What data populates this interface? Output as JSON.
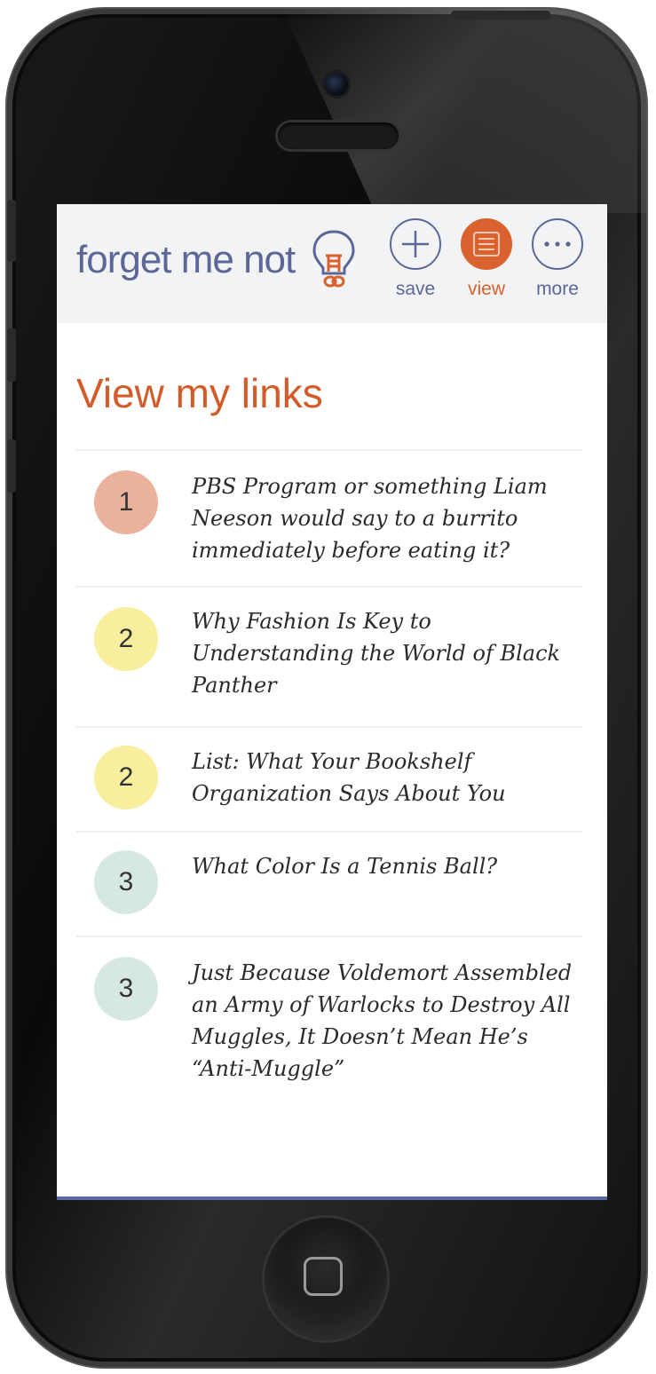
{
  "app": {
    "logo_text": "forget me not"
  },
  "nav": {
    "save_label": "save",
    "view_label": "view",
    "more_label": "more"
  },
  "page": {
    "title": "View my links"
  },
  "links": [
    {
      "rank": "1",
      "title": "PBS Program or something Liam Neeson would say to a burrito immediately before eating it?",
      "color": "#eab19c"
    },
    {
      "rank": "2",
      "title": "Why Fashion Is Key to Understanding the World of Black Panther",
      "color": "#f7ee9e"
    },
    {
      "rank": "2",
      "title": "List: What Your Bookshelf Organization Says About You",
      "color": "#f7ee9e"
    },
    {
      "rank": "3",
      "title": "What Color Is a Tennis Ball?",
      "color": "#d6e8e3"
    },
    {
      "rank": "3",
      "title": "Just Because Voldemort Assembled an Army of Warlocks to Destroy All Muggles, It Doesn’t Mean He’s “Anti-Muggle”",
      "color": "#d6e8e3"
    }
  ],
  "colors": {
    "brand_blue": "#5c6797",
    "accent_orange": "#d9622e",
    "header_bg": "#f1f3f4"
  },
  "icons": {
    "logo": "lightbulb-icon",
    "save": "plus-icon",
    "view": "list-icon",
    "more": "ellipsis-icon",
    "home": "home-button-icon"
  }
}
